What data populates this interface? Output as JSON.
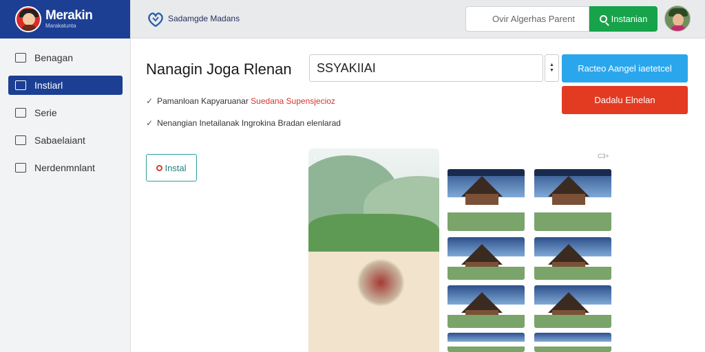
{
  "brand": {
    "name": "Merakin",
    "subtitle": "Marakatunta"
  },
  "topbar": {
    "title": "Sadamgde Madans",
    "search_placeholder": "Ovir Algerhas Parent",
    "search_button": "Instanian"
  },
  "sidebar": {
    "items": [
      {
        "label": "Benagan",
        "active": false
      },
      {
        "label": "Instiarl",
        "active": true
      },
      {
        "label": "Serie",
        "active": false
      },
      {
        "label": "Sabaelaiant",
        "active": false
      },
      {
        "label": "Nerdenmnlant",
        "active": false
      }
    ]
  },
  "main": {
    "title": "Nanagin Joga Rlenan",
    "input_value": "SSYAKIIAI",
    "primary_button": "Racteo Aangel iaetetcel",
    "danger_button": "Dadalu Elnelan",
    "info_line_1": {
      "prefix": "Pamanloan Kapyaruanar",
      "highlight": "Suedana  Supensjecioz"
    },
    "info_line_2": "Nenangian Inetailanak Ingrokina Bradan elenlarad",
    "install_button": "Instal",
    "corner_tag": "C3+"
  },
  "colors": {
    "brand": "#1c3f94",
    "search_button": "#17a34a",
    "primary_button": "#2aa7ec",
    "danger_button": "#e33a22",
    "install_border": "#2a9d9a"
  }
}
